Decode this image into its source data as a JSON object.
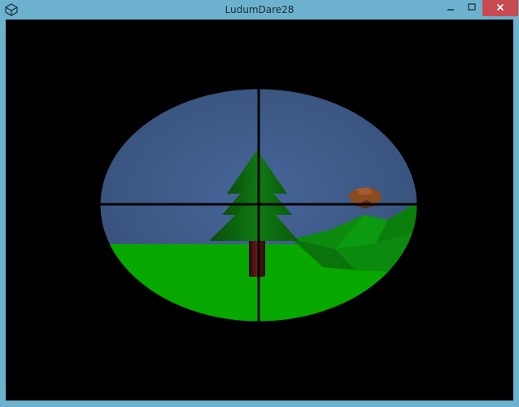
{
  "window": {
    "title": "LudumDare28",
    "app_icon": "unity-icon",
    "controls": {
      "minimize": "minimize-icon",
      "maximize": "maximize-icon",
      "close": "close-icon"
    }
  },
  "scene": {
    "view": "sniper-scope",
    "colors": {
      "sky": "#3e5a84",
      "ground": "#07a800",
      "crosshair": "#000000",
      "tree": "#0b6a0b",
      "trunk": "#5a1414",
      "rock": "#8a4a22",
      "titlebar": "#6cb2cf",
      "close_button": "#c74b50"
    }
  }
}
